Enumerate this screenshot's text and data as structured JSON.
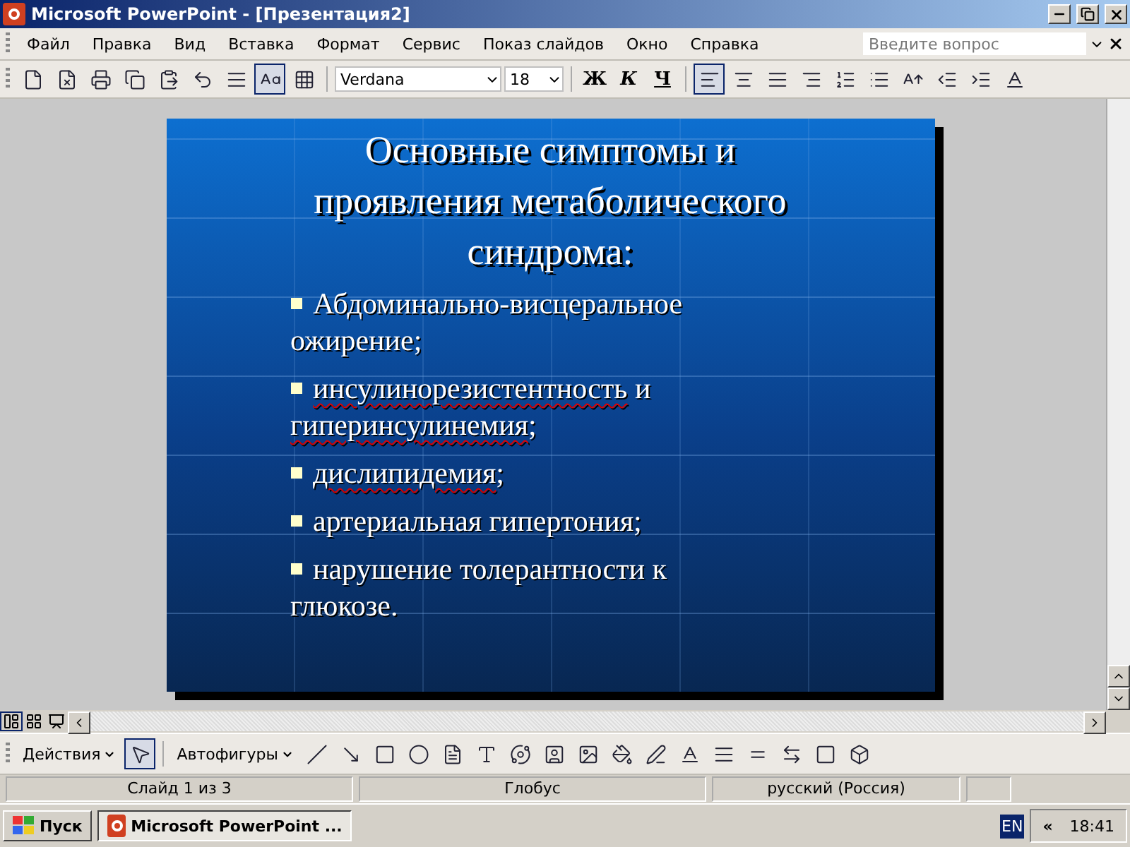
{
  "window": {
    "title": "Microsoft PowerPoint - [Презентация2]"
  },
  "menu": {
    "items": [
      "Файл",
      "Правка",
      "Вид",
      "Вставка",
      "Формат",
      "Сервис",
      "Показ слайдов",
      "Окно",
      "Справка"
    ],
    "help_placeholder": "Введите вопрос"
  },
  "standard_tools": [
    {
      "kind": "new",
      "pressed": false
    },
    {
      "kind": "permission",
      "pressed": false
    },
    {
      "kind": "print",
      "pressed": false
    },
    {
      "kind": "copy",
      "pressed": false
    },
    {
      "kind": "paste",
      "pressed": false
    },
    {
      "kind": "undo",
      "pressed": false
    },
    {
      "kind": "expand",
      "pressed": false
    },
    {
      "kind": "formatting",
      "pressed": true
    },
    {
      "kind": "grid",
      "pressed": false
    }
  ],
  "formatting": {
    "font": "Verdana",
    "size": "18",
    "style_buttons": [
      {
        "kind": "bold",
        "label": "Ж"
      },
      {
        "kind": "italic",
        "label": "К"
      },
      {
        "kind": "underline",
        "label": "Ч"
      }
    ],
    "tools": [
      {
        "kind": "align-left",
        "pressed": true
      },
      {
        "kind": "align-center",
        "pressed": false
      },
      {
        "kind": "justify",
        "pressed": false
      },
      {
        "kind": "align-right",
        "pressed": false
      },
      {
        "kind": "numbering",
        "pressed": false
      },
      {
        "kind": "bullets",
        "pressed": false
      },
      {
        "kind": "grow",
        "pressed": false
      },
      {
        "kind": "outdent",
        "pressed": false
      },
      {
        "kind": "indent",
        "pressed": false
      },
      {
        "kind": "font-color",
        "pressed": false
      }
    ]
  },
  "slide": {
    "title": "Основные симптомы и проявления метаболического синдрома:",
    "bullets": [
      {
        "parts": [
          {
            "text": "Абдоминально-висцеральное ожирение;",
            "misspelled": false
          }
        ]
      },
      {
        "parts": [
          {
            "text": "инсулинорезистентность",
            "misspelled": true
          },
          {
            "text": " и ",
            "misspelled": false
          },
          {
            "text": "гиперинсулинемия",
            "misspelled": true
          },
          {
            "text": ";",
            "misspelled": false
          }
        ]
      },
      {
        "parts": [
          {
            "text": "дислипидемия",
            "misspelled": true
          },
          {
            "text": ";",
            "misspelled": false
          }
        ]
      },
      {
        "parts": [
          {
            "text": "артериальная гипертония;",
            "misspelled": false
          }
        ]
      },
      {
        "parts": [
          {
            "text": "нарушение толерантности к глюкозе.",
            "misspelled": false
          }
        ]
      }
    ]
  },
  "views": [
    {
      "kind": "normal",
      "selected": true
    },
    {
      "kind": "sorter",
      "selected": false
    },
    {
      "kind": "show",
      "selected": false
    }
  ],
  "drawing": {
    "actions": "Действия",
    "autoshapes": "Автофигуры",
    "tools": [
      {
        "kind": "pointer",
        "pressed": true
      },
      {
        "kind": "line",
        "pressed": false
      },
      {
        "kind": "arrow",
        "pressed": false
      },
      {
        "kind": "rectangle",
        "pressed": false
      },
      {
        "kind": "oval",
        "pressed": false
      },
      {
        "kind": "textbox",
        "pressed": false
      },
      {
        "kind": "wordart",
        "pressed": false
      },
      {
        "kind": "diagram",
        "pressed": false
      },
      {
        "kind": "clipart",
        "pressed": false
      },
      {
        "kind": "picture",
        "pressed": false
      },
      {
        "kind": "fill",
        "pressed": false
      },
      {
        "kind": "line-color",
        "pressed": false
      },
      {
        "kind": "font-color",
        "pressed": false
      },
      {
        "kind": "line-style",
        "pressed": false
      },
      {
        "kind": "dash-style",
        "pressed": false
      },
      {
        "kind": "arrow-style",
        "pressed": false
      },
      {
        "kind": "shadow",
        "pressed": false
      },
      {
        "kind": "cube",
        "pressed": false
      }
    ]
  },
  "status_bar": [
    "Слайд 1 из 3",
    "Глобус",
    "русский (Россия)"
  ],
  "taskbar": {
    "start": "Пуск",
    "task": "Microsoft PowerPoint ...",
    "language": "EN",
    "tray_toggle": "«",
    "clock": "18:41"
  }
}
